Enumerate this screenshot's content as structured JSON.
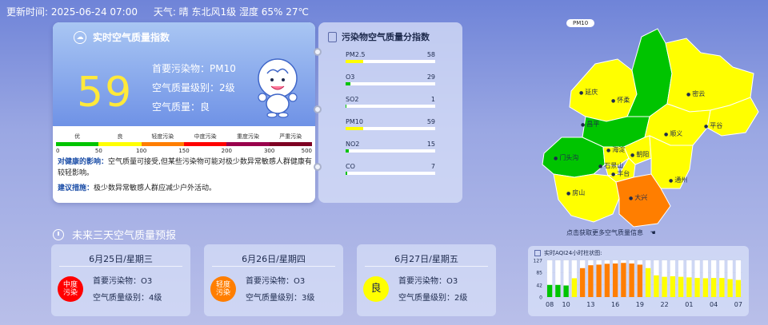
{
  "header": {
    "update_time": "更新时间:  2025-06-24 07:00",
    "weather": "天气: 晴 东北风1级 湿度 65% 27℃"
  },
  "aqi": {
    "title": "实时空气质量指数",
    "value": "59",
    "primary_pollutant": "首要污染物：PM10",
    "level": "空气质量级别：2级",
    "quality": "空气质量：良",
    "scale_labels": [
      "优",
      "良",
      "轻度污染",
      "中度污染",
      "重度污染",
      "严重污染"
    ],
    "scale_colors": [
      "#00c400",
      "#ffff00",
      "#ff7e00",
      "#ff0000",
      "#99004c",
      "#7e0023"
    ],
    "scale_ticks": [
      "0",
      "50",
      "100",
      "150",
      "200",
      "300",
      "500"
    ],
    "health_label": "对健康的影响：",
    "health_text": "空气质量可接受,但某些污染物可能对极少数异常敏感人群健康有较轻影响。",
    "advice_label": "建议措施：",
    "advice_text": "极少数异常敏感人群应减少户外活动。"
  },
  "pollutants": {
    "title": "污染物空气质量分指数",
    "items": [
      {
        "name": "PM2.5",
        "value": "58",
        "fraction": 0.2,
        "color": "#ffff00"
      },
      {
        "name": "O3",
        "value": "29",
        "fraction": 0.05,
        "color": "#00c400"
      },
      {
        "name": "SO2",
        "value": "1",
        "fraction": 0.01,
        "color": "#00c400"
      },
      {
        "name": "PM10",
        "value": "59",
        "fraction": 0.2,
        "color": "#ffff00"
      },
      {
        "name": "NO2",
        "value": "15",
        "fraction": 0.04,
        "color": "#00c400"
      },
      {
        "name": "CO",
        "value": "7",
        "fraction": 0.02,
        "color": "#00c400"
      }
    ]
  },
  "map": {
    "badge": "PM10",
    "hint": "点击获取更多空气质量信息",
    "districts": [
      "延庆",
      "怀柔",
      "密云",
      "昌平",
      "平谷",
      "顺义",
      "门头沟",
      "海淀",
      "朝阳",
      "石景山",
      "丰台",
      "通州",
      "房山",
      "大兴"
    ]
  },
  "forecast": {
    "title": "未来三天空气质量预报",
    "days": [
      {
        "date": "6月25日/星期三",
        "badge": "中度污染",
        "badge_color": "#ff0000",
        "pollutant": "首要污染物：O3",
        "level": "空气质量级别：4级"
      },
      {
        "date": "6月26日/星期四",
        "badge": "轻度污染",
        "badge_color": "#ff7e00",
        "pollutant": "首要污染物：O3",
        "level": "空气质量级别：3级"
      },
      {
        "date": "6月27日/星期五",
        "badge": "良",
        "badge_color": "#ffff00",
        "pollutant": "首要污染物：O3",
        "level": "空气质量级别：2级"
      }
    ]
  },
  "chart_data": {
    "type": "bar",
    "title": "实时AQI24小时柱状图:",
    "y_ticks": [
      127,
      85,
      42,
      0
    ],
    "ylim": [
      0,
      127
    ],
    "x_labels": [
      "08",
      "10",
      "13",
      "16",
      "19",
      "22",
      "01",
      "04",
      "07"
    ],
    "hours": [
      "08",
      "09",
      "10",
      "11",
      "12",
      "13",
      "14",
      "15",
      "16",
      "17",
      "18",
      "19",
      "20",
      "21",
      "22",
      "23",
      "00",
      "01",
      "02",
      "03",
      "04",
      "05",
      "06",
      "07"
    ],
    "values": [
      42,
      42,
      40,
      65,
      100,
      110,
      112,
      115,
      116,
      118,
      116,
      112,
      100,
      75,
      70,
      72,
      70,
      68,
      66,
      65,
      66,
      66,
      62,
      59
    ],
    "colors": [
      "#00c400",
      "#00c400",
      "#00c400",
      "#ffff00",
      "#ff7e00",
      "#ff7e00",
      "#ff7e00",
      "#ff7e00",
      "#ff7e00",
      "#ff7e00",
      "#ff7e00",
      "#ff7e00",
      "#ffff00",
      "#ffff00",
      "#ffff00",
      "#ffff00",
      "#ffff00",
      "#ffff00",
      "#ffff00",
      "#ffff00",
      "#ffff00",
      "#ffff00",
      "#ffff00",
      "#ffff00"
    ]
  }
}
